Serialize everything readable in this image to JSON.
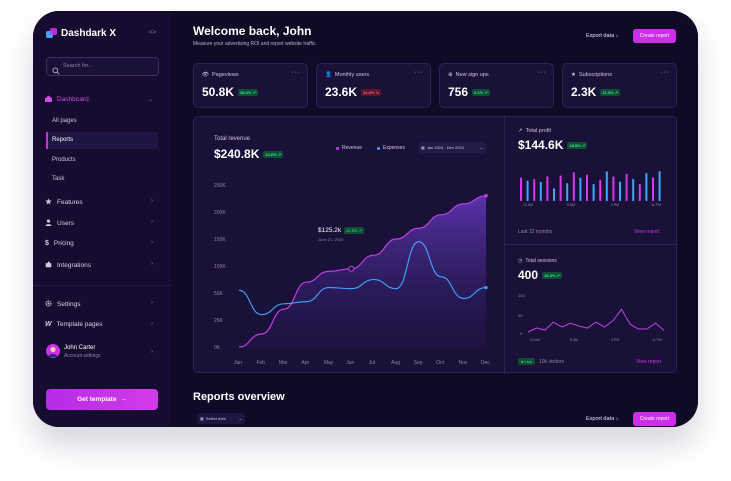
{
  "app": {
    "name": "Dashdark X",
    "collapse_icon": "<>"
  },
  "search": {
    "placeholder": "Search for..."
  },
  "sidebar": {
    "dashboard": "Dashboard",
    "sub_items": [
      "All pages",
      "Reports",
      "Products",
      "Task"
    ],
    "items": [
      {
        "label": "Features",
        "icon": "star-icon"
      },
      {
        "label": "Users",
        "icon": "user-icon"
      },
      {
        "label": "Pricing",
        "icon": "dollar-icon"
      },
      {
        "label": "Integrations",
        "icon": "puzzle-icon"
      }
    ],
    "settings": "Settings",
    "template_pages": "Template pages",
    "user_name": "John Carter",
    "user_sub": "Account settings",
    "cta": "Get template"
  },
  "header": {
    "title": "Welcome back, John",
    "subtitle": "Measure your advertising ROI and report website traffic.",
    "export": "Export data",
    "create": "Create report"
  },
  "stats": [
    {
      "label": "Pageviews",
      "value": "50.8K",
      "delta": "28.4%",
      "dir": "up"
    },
    {
      "label": "Monthly users",
      "value": "23.6K",
      "delta": "12.6%",
      "dir": "down"
    },
    {
      "label": "New sign ups",
      "value": "756",
      "delta": "3.1%",
      "dir": "up"
    },
    {
      "label": "Subscriptions",
      "value": "2.3K",
      "delta": "11.3%",
      "dir": "up"
    }
  ],
  "revenue": {
    "label": "Total revenue",
    "value": "$240.8K",
    "delta": "24.6%",
    "legend_revenue": "Revenue",
    "legend_expenses": "Expenses",
    "range": "Jan 2024 - Dec 2024",
    "tooltip_value": "$125.2k",
    "tooltip_delta": "12.5%",
    "tooltip_date": "June 21, 2023"
  },
  "profit": {
    "label": "Total profit",
    "value": "$144.6K",
    "delta": "28.5%",
    "x_labels": [
      "12 AM",
      "8 AM",
      "4 PM",
      "11 PM"
    ],
    "footer": "Last 12 months",
    "link": "View report"
  },
  "sessions": {
    "label": "Total sessions",
    "value": "400",
    "delta": "16.8%",
    "y_labels": [
      "100",
      "50",
      "0"
    ],
    "x_labels": [
      "12 AM",
      "8 AM",
      "4 PM",
      "11 PM"
    ],
    "live": "Live",
    "visitors": "10k visitors",
    "link": "View report"
  },
  "overview": {
    "title": "Reports overview",
    "select": "Select date",
    "export": "Export data",
    "create": "Create report"
  },
  "chart_data": {
    "type": "area",
    "categories": [
      "Jan",
      "Feb",
      "Mar",
      "Apr",
      "May",
      "Jun",
      "Jul",
      "Aug",
      "Sep",
      "Oct",
      "Nov",
      "Dec"
    ],
    "ylim": [
      0,
      250
    ],
    "y_ticks": [
      "0K",
      "25K",
      "50K",
      "100K",
      "150K",
      "200K",
      "250K"
    ],
    "series": [
      {
        "name": "Revenue",
        "values": [
          0,
          12,
          35,
          70,
          90,
          95,
          120,
          150,
          170,
          195,
          215,
          230
        ],
        "color": "#c03fe8"
      },
      {
        "name": "Expenses",
        "values": [
          55,
          30,
          40,
          42,
          60,
          58,
          75,
          58,
          145,
          80,
          45,
          60
        ],
        "color": "#3ea6ff"
      }
    ]
  },
  "profit_chart": {
    "type": "bar",
    "values": [
      55,
      48,
      52,
      45,
      58,
      30,
      60,
      42,
      68,
      55,
      62,
      40,
      50,
      70,
      58,
      46,
      64,
      52,
      40,
      66,
      56,
      70
    ],
    "colors": [
      "#d23be8",
      "#3ea6ff"
    ]
  },
  "sessions_chart": {
    "type": "line",
    "values": [
      2,
      10,
      6,
      22,
      12,
      20,
      14,
      10,
      22,
      12,
      25,
      48,
      18,
      8,
      8,
      20,
      5
    ],
    "ylim": [
      0,
      100
    ]
  },
  "colors": {
    "accent": "#cd2ee8",
    "bg": "#120a2a",
    "card": "#1a1138",
    "blue": "#3ea6ff"
  }
}
